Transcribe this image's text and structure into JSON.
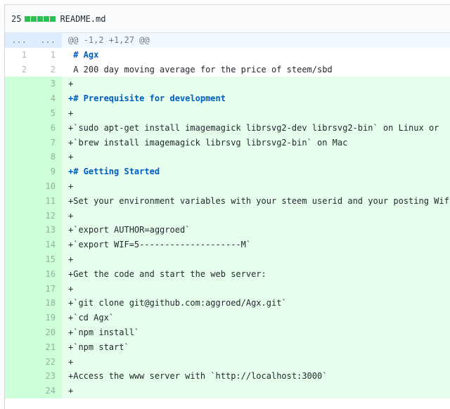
{
  "file": {
    "change_count": "25",
    "name": "README.md",
    "diffstat_color": "#2cbe4e",
    "diffstat_blocks": 5
  },
  "hunk": {
    "old_num": "...",
    "new_num": "...",
    "text": "@@ -1,2 +1,27 @@"
  },
  "lines": [
    {
      "type": "context",
      "old": "1",
      "new": "1",
      "text": " # Agx",
      "heading": true
    },
    {
      "type": "context",
      "old": "2",
      "new": "2",
      "text": " A 200 day moving average for the price of steem/sbd"
    },
    {
      "type": "add",
      "old": "",
      "new": "3",
      "text": "+"
    },
    {
      "type": "add",
      "old": "",
      "new": "4",
      "text": "+# Prerequisite for development",
      "heading": true
    },
    {
      "type": "add",
      "old": "",
      "new": "5",
      "text": "+"
    },
    {
      "type": "add",
      "old": "",
      "new": "6",
      "text": "+`sudo apt-get install imagemagick librsvg2-dev librsvg2-bin` on Linux or"
    },
    {
      "type": "add",
      "old": "",
      "new": "7",
      "text": "+`brew install imagemagick librsvg librsvg2-bin` on Mac"
    },
    {
      "type": "add",
      "old": "",
      "new": "8",
      "text": "+"
    },
    {
      "type": "add",
      "old": "",
      "new": "9",
      "text": "+# Getting Started",
      "heading": true
    },
    {
      "type": "add",
      "old": "",
      "new": "10",
      "text": "+"
    },
    {
      "type": "add",
      "old": "",
      "new": "11",
      "text": "+Set your environment variables with your steem userid and your posting Wif key:"
    },
    {
      "type": "add",
      "old": "",
      "new": "12",
      "text": "+"
    },
    {
      "type": "add",
      "old": "",
      "new": "13",
      "text": "+`export AUTHOR=aggroed`"
    },
    {
      "type": "add",
      "old": "",
      "new": "14",
      "text": "+`export WIF=5--------------------M`"
    },
    {
      "type": "add",
      "old": "",
      "new": "15",
      "text": "+"
    },
    {
      "type": "add",
      "old": "",
      "new": "16",
      "text": "+Get the code and start the web server:"
    },
    {
      "type": "add",
      "old": "",
      "new": "17",
      "text": "+"
    },
    {
      "type": "add",
      "old": "",
      "new": "18",
      "text": "+`git clone git@github.com:aggroed/Agx.git`"
    },
    {
      "type": "add",
      "old": "",
      "new": "19",
      "text": "+`cd Agx`"
    },
    {
      "type": "add",
      "old": "",
      "new": "20",
      "text": "+`npm install`"
    },
    {
      "type": "add",
      "old": "",
      "new": "21",
      "text": "+`npm start`"
    },
    {
      "type": "add",
      "old": "",
      "new": "22",
      "text": "+"
    },
    {
      "type": "add",
      "old": "",
      "new": "23",
      "text": "+Access the www server with `http://localhost:3000`"
    },
    {
      "type": "add",
      "old": "",
      "new": "24",
      "text": "+"
    }
  ]
}
